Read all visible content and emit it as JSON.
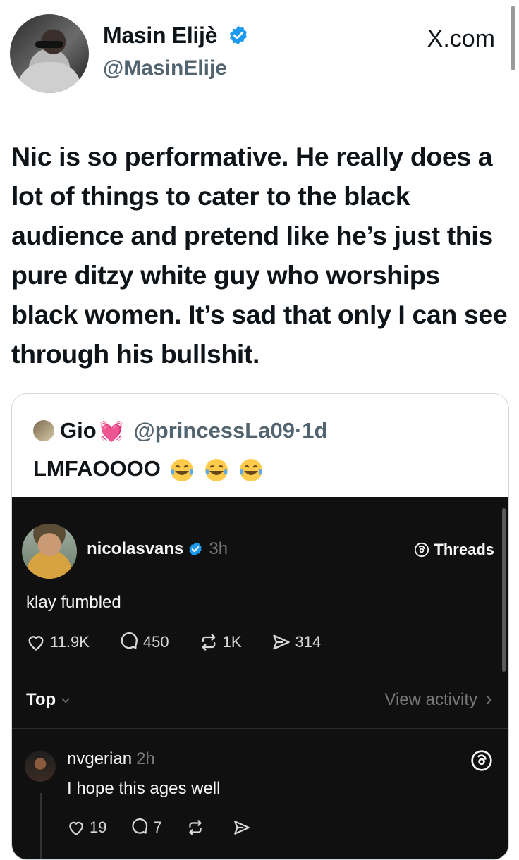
{
  "tweet": {
    "author_name": "Masin Elijè",
    "author_handle": "@MasinElije",
    "site": "X.com",
    "text": "Nic is so performative. He really does a lot of things to cater to the black audience and pretend like he’s just this pure ditzy white guy who worships black women. It’s sad that only I can see through his bullshit."
  },
  "quote": {
    "name": "Gio",
    "heart_emoji": "💓",
    "handle_time": "@princessLa09·1d",
    "text": "LMFAOOOO",
    "emoji_icon": "laughing-tears-emoji"
  },
  "threads_post": {
    "username": "nicolasvans",
    "time": "3h",
    "brand": "Threads",
    "body": "klay fumbled",
    "likes": "11.9K",
    "replies": "450",
    "reposts": "1K",
    "shares": "314",
    "sort_label": "Top",
    "view_activity": "View activity"
  },
  "reply": {
    "username": "nvgerian",
    "time": "2h",
    "text": "I hope this ages well",
    "likes": "19",
    "replies": "7"
  },
  "colors": {
    "verified_blue": "#1d9bf0",
    "text_dark": "#0f1419",
    "handle_gray": "#536471",
    "threads_bg": "#101010"
  }
}
